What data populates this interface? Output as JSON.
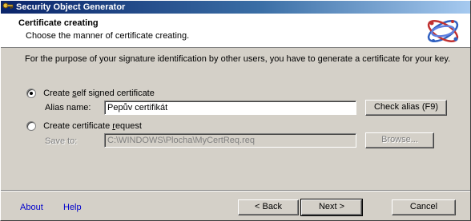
{
  "window": {
    "title": "Security Object Generator"
  },
  "header": {
    "title": "Certificate creating",
    "subtitle": "Choose the manner of certificate creating."
  },
  "intro": "For the purpose of your signature identification by other users, you have to generate a certificate for your key.",
  "options": {
    "self_signed": {
      "label_pre": "Create ",
      "label_accel": "s",
      "label_post": "elf signed certificate",
      "selected": true
    },
    "alias": {
      "label": "Alias name:",
      "value": "Pepův certifikát",
      "check_button": "Check alias (F9)"
    },
    "request": {
      "label_pre": "Create certificate ",
      "label_accel": "r",
      "label_post": "equest",
      "selected": false
    },
    "save_to": {
      "label": "Save to:",
      "value": "C:\\WINDOWS\\Plocha\\MyCertReq.req",
      "browse_button": "Browse..."
    }
  },
  "footer": {
    "about": "About",
    "help": "Help",
    "back": "< Back",
    "next": "Next >",
    "cancel": "Cancel"
  }
}
